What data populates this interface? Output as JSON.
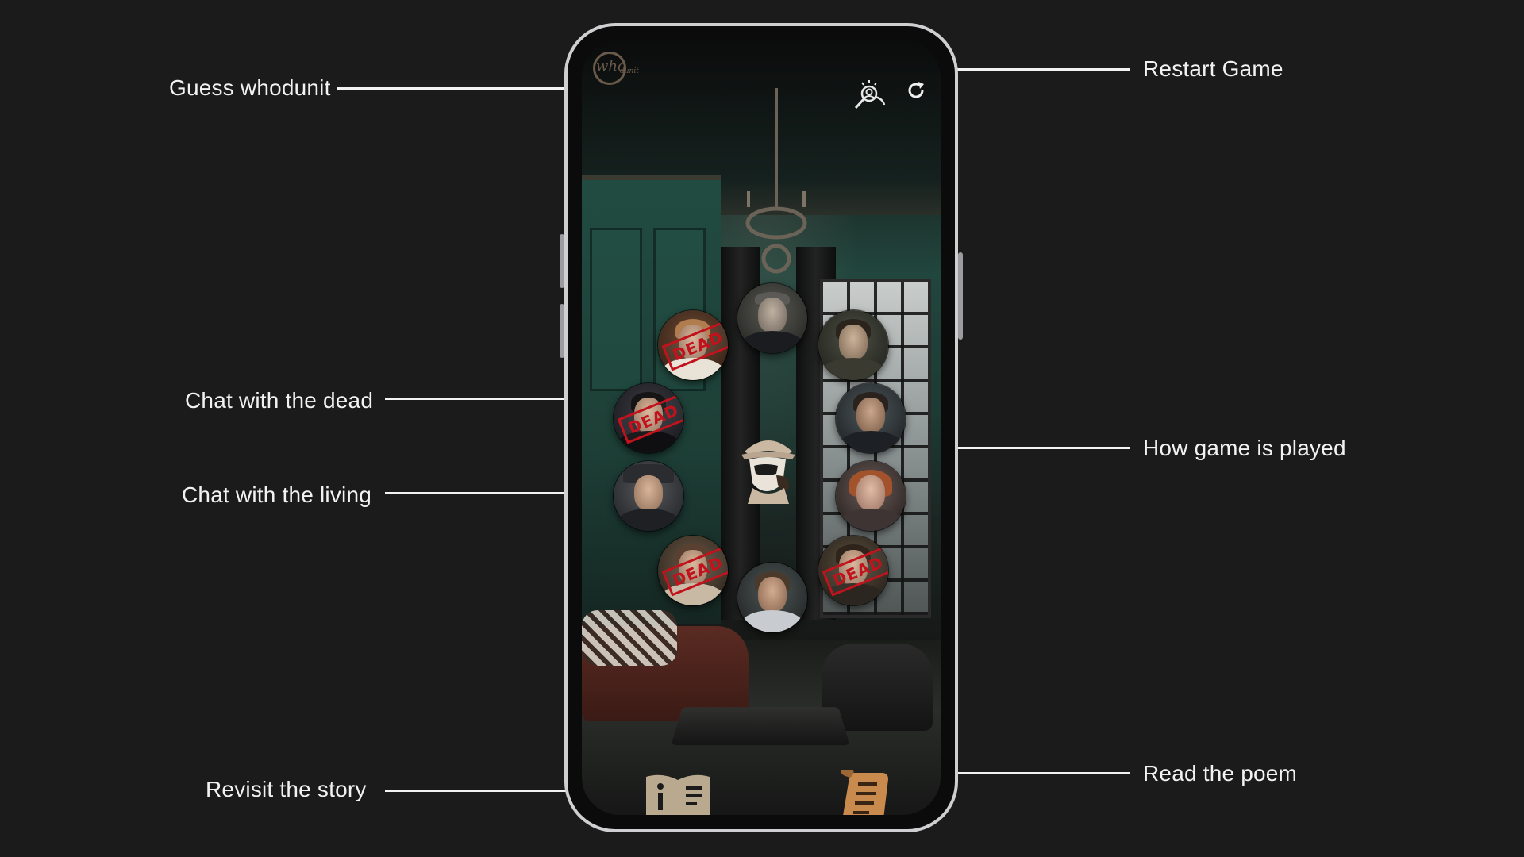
{
  "annotations": {
    "guess_whodunit": "Guess whodunit",
    "restart_game": "Restart Game",
    "chat_dead": "Chat with the dead",
    "chat_living": "Chat with the living",
    "how_played": "How game is played",
    "revisit_story": "Revisit the story",
    "read_poem": "Read the poem"
  },
  "app": {
    "logo_text": "who",
    "logo_suffix": "dunit"
  },
  "characters": [
    {
      "name": "character-1",
      "status": "dead",
      "stamp": "DEAD"
    },
    {
      "name": "character-2",
      "status": "alive"
    },
    {
      "name": "character-3",
      "status": "alive"
    },
    {
      "name": "character-4",
      "status": "dead",
      "stamp": "DEAD"
    },
    {
      "name": "character-5",
      "status": "alive"
    },
    {
      "name": "character-6",
      "status": "alive"
    },
    {
      "name": "character-7",
      "status": "alive"
    },
    {
      "name": "character-8",
      "status": "dead",
      "stamp": "DEAD"
    },
    {
      "name": "character-9",
      "status": "alive"
    },
    {
      "name": "character-10",
      "status": "dead",
      "stamp": "DEAD"
    }
  ],
  "icons": {
    "guess": "detective-magnifier-icon",
    "restart": "restart-icon",
    "help": "detective-icon",
    "story": "book-info-icon",
    "poem": "scroll-icon"
  },
  "colors": {
    "background": "#1c1b1c",
    "annotation": "#f2f2f2",
    "stamp": "#c2121c",
    "scroll": "#c98a4e",
    "book": "#b9a98f"
  }
}
